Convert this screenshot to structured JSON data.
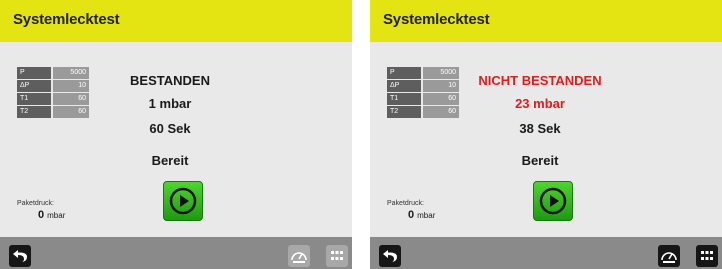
{
  "screens": [
    {
      "title": "Systemlecktest",
      "params": [
        {
          "key": "P",
          "value": "5000"
        },
        {
          "key": "ΔP",
          "value": "10"
        },
        {
          "key": "T1",
          "value": "60"
        },
        {
          "key": "T2",
          "value": "60"
        }
      ],
      "status": "BESTANDEN",
      "pressure": "1 mbar",
      "time": "60 Sek",
      "ready": "Bereit",
      "package_label": "Paketdruck:",
      "package_value": "0",
      "package_unit": "mbar",
      "status_color": "#1a1a1a",
      "footer_buttons_enabled": false
    },
    {
      "title": "Systemlecktest",
      "params": [
        {
          "key": "P",
          "value": "5000"
        },
        {
          "key": "ΔP",
          "value": "10"
        },
        {
          "key": "T1",
          "value": "60"
        },
        {
          "key": "T2",
          "value": "60"
        }
      ],
      "status": "NICHT BESTANDEN",
      "pressure": "23 mbar",
      "time": "38 Sek",
      "ready": "Bereit",
      "package_label": "Paketdruck:",
      "package_value": "0",
      "package_unit": "mbar",
      "status_color": "#e21b1b",
      "footer_buttons_enabled": true
    }
  ],
  "icons": {
    "back": "back-arrow-icon",
    "play": "play-icon",
    "gauge": "gauge-icon",
    "grid": "grid-icon"
  },
  "colors": {
    "header": "#e4e413",
    "fail": "#e21b1b",
    "play_green": "#2fb41f"
  }
}
